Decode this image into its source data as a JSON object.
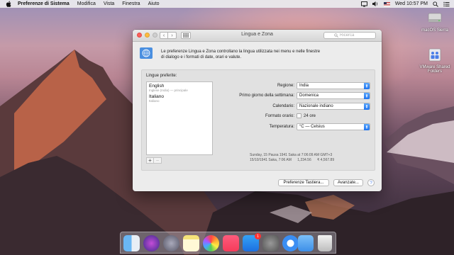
{
  "menubar": {
    "app_name": "Preferenze di Sistema",
    "items": [
      "Modifica",
      "Vista",
      "Finestra",
      "Aiuto"
    ],
    "clock": "Wed 10:57 PM"
  },
  "desktop": {
    "icons": [
      {
        "label": "macOS Sierra",
        "icon": "hard-drive-icon"
      },
      {
        "label": "VMware Shared Folders",
        "icon": "shared-folder-icon"
      }
    ]
  },
  "window": {
    "title": "Lingua e Zona",
    "search_placeholder": "Ricerca",
    "description_line1": "Le preferenze Lingua e Zona controllano la lingua utilizzata nei menu e nelle finestre",
    "description_line2": "di dialogo e i formati di date, orari e valute.",
    "preferred_label": "Lingue preferite:",
    "languages": [
      {
        "name": "English",
        "sub": "Inglese (India) — principale"
      },
      {
        "name": "Italiano",
        "sub": "Italiano"
      }
    ],
    "add_label": "+",
    "remove_label": "−",
    "settings": {
      "region_label": "Regione:",
      "region_value": "India",
      "first_day_label": "Primo giorno della settimana:",
      "first_day_value": "Domenica",
      "calendar_label": "Calendario:",
      "calendar_value": "Nazionale indiano",
      "time_format_label": "Formato orario:",
      "time_format_option": "24 ore",
      "time_format_checked": false,
      "temperature_label": "Temperatura:",
      "temperature_value": "°C — Celsius"
    },
    "sample_line1": "Sunday, 15 Pausa 1941 Saka at 7:06:09 AM GMT+3",
    "sample_line2": "15/10/1941 Saka, 7:06 AM      1,234.56      ₹ 4,567.89",
    "keyboard_button": "Preferenze Tastiera...",
    "advanced_button": "Avanzate...",
    "help_label": "?"
  },
  "dock": {
    "badge_count": "1"
  },
  "colors": {
    "accent": "#1f74ef",
    "close": "#fc605b",
    "minimize": "#fdbc40"
  }
}
